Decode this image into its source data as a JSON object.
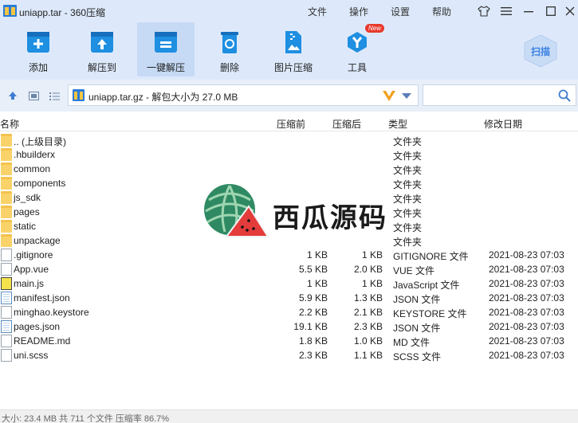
{
  "window": {
    "title": "uniapp.tar - 360压缩",
    "menus": [
      "文件",
      "操作",
      "设置",
      "帮助"
    ]
  },
  "toolbar": {
    "tools": [
      {
        "label": "添加",
        "icon": "add-box-icon"
      },
      {
        "label": "解压到",
        "icon": "extract-to-icon"
      },
      {
        "label": "一键解压",
        "icon": "one-click-extract-icon"
      },
      {
        "label": "删除",
        "icon": "recycle-bin-icon"
      },
      {
        "label": "图片压缩",
        "icon": "image-compress-icon"
      },
      {
        "label": "工具",
        "icon": "tools-icon"
      }
    ],
    "new_badge": "New",
    "scan_label": "扫描"
  },
  "address": {
    "path": "uniapp.tar.gz - 解包大小为 27.0 MB"
  },
  "columns": {
    "name": "名称",
    "size": "压缩前",
    "packed": "压缩后",
    "type": "类型",
    "modified": "修改日期"
  },
  "files": [
    {
      "name": ".. (上级目录)",
      "size": "",
      "packed": "",
      "type": "文件夹",
      "modified": "",
      "kind": "folder"
    },
    {
      "name": ".hbuilderx",
      "size": "",
      "packed": "",
      "type": "文件夹",
      "modified": "",
      "kind": "folder"
    },
    {
      "name": "common",
      "size": "",
      "packed": "",
      "type": "文件夹",
      "modified": "",
      "kind": "folder"
    },
    {
      "name": "components",
      "size": "",
      "packed": "",
      "type": "文件夹",
      "modified": "",
      "kind": "folder"
    },
    {
      "name": "js_sdk",
      "size": "",
      "packed": "",
      "type": "文件夹",
      "modified": "",
      "kind": "folder"
    },
    {
      "name": "pages",
      "size": "",
      "packed": "",
      "type": "文件夹",
      "modified": "",
      "kind": "folder"
    },
    {
      "name": "static",
      "size": "",
      "packed": "",
      "type": "文件夹",
      "modified": "",
      "kind": "folder"
    },
    {
      "name": "unpackage",
      "size": "",
      "packed": "",
      "type": "文件夹",
      "modified": "",
      "kind": "folder"
    },
    {
      "name": ".gitignore",
      "size": "1 KB",
      "packed": "1 KB",
      "type": "GITIGNORE 文件",
      "modified": "2021-08-23 07:03",
      "kind": "file"
    },
    {
      "name": "App.vue",
      "size": "5.5 KB",
      "packed": "2.0 KB",
      "type": "VUE 文件",
      "modified": "2021-08-23 07:03",
      "kind": "file"
    },
    {
      "name": "main.js",
      "size": "1 KB",
      "packed": "1 KB",
      "type": "JavaScript 文件",
      "modified": "2021-08-23 07:03",
      "kind": "js"
    },
    {
      "name": "manifest.json",
      "size": "5.9 KB",
      "packed": "1.3 KB",
      "type": "JSON 文件",
      "modified": "2021-08-23 07:03",
      "kind": "json"
    },
    {
      "name": "minghao.keystore",
      "size": "2.2 KB",
      "packed": "2.1 KB",
      "type": "KEYSTORE 文件",
      "modified": "2021-08-23 07:03",
      "kind": "file"
    },
    {
      "name": "pages.json",
      "size": "19.1 KB",
      "packed": "2.3 KB",
      "type": "JSON 文件",
      "modified": "2021-08-23 07:03",
      "kind": "json"
    },
    {
      "name": "README.md",
      "size": "1.8 KB",
      "packed": "1.0 KB",
      "type": "MD 文件",
      "modified": "2021-08-23 07:03",
      "kind": "file"
    },
    {
      "name": "uni.scss",
      "size": "2.3 KB",
      "packed": "1.1 KB",
      "type": "SCSS 文件",
      "modified": "2021-08-23 07:03",
      "kind": "file"
    }
  ],
  "watermark": {
    "text": "西瓜源码"
  },
  "status": {
    "text": "大小: 23.4 MB 共 711 个文件 压缩率 86.7%"
  },
  "colors": {
    "toolbar_bg": "#dde9fb",
    "accent": "#1e8fe1"
  }
}
